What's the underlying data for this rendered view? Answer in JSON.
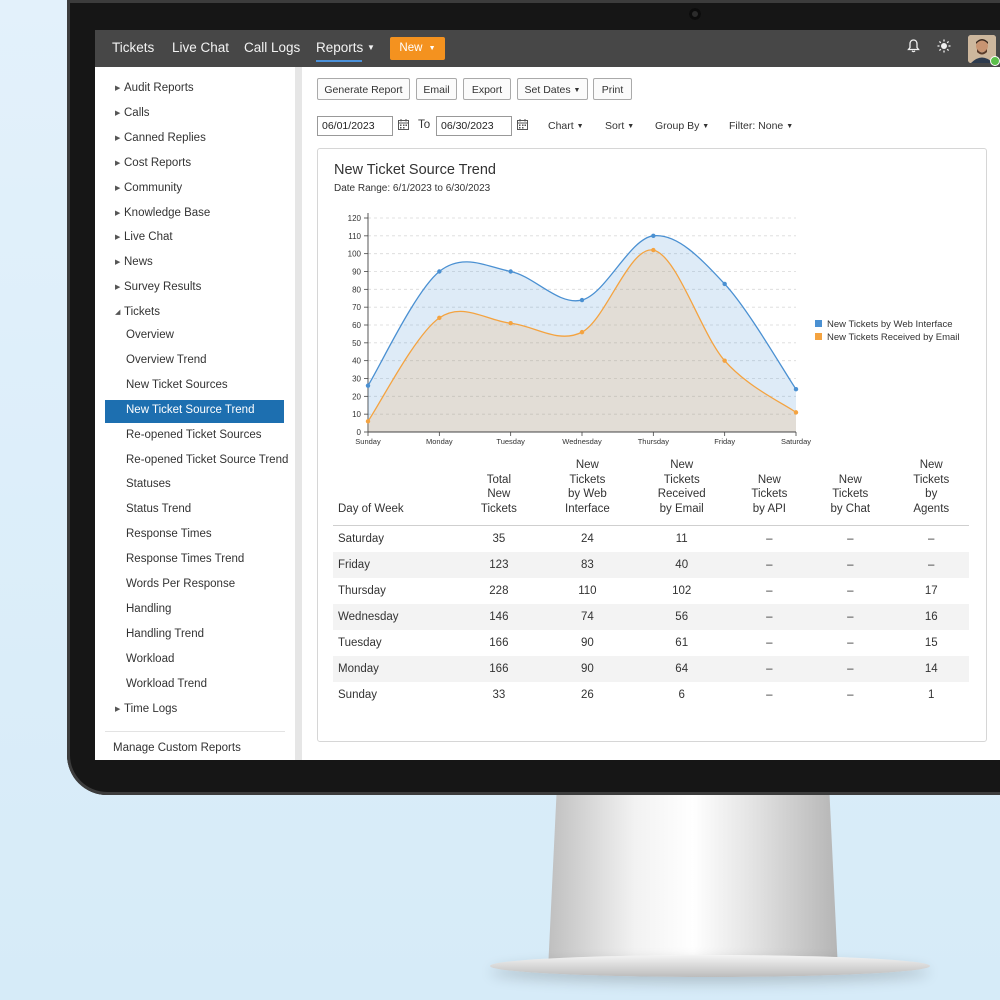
{
  "nav": {
    "tickets": "Tickets",
    "live_chat": "Live Chat",
    "call_logs": "Call Logs",
    "reports": "Reports",
    "new_button": "New",
    "bell_icon": "bell-icon",
    "theme_icon": "sun-icon"
  },
  "sidebar": {
    "groups": [
      "Audit Reports",
      "Calls",
      "Canned Replies",
      "Cost Reports",
      "Community",
      "Knowledge Base",
      "Live Chat",
      "News",
      "Survey Results",
      "Tickets"
    ],
    "tickets_items": [
      "Overview",
      "Overview Trend",
      "New Ticket Sources",
      "New Ticket Source Trend",
      "Re-opened Ticket Sources",
      "Re-opened Ticket Source Trend",
      "Statuses",
      "Status Trend",
      "Response Times",
      "Response Times Trend",
      "Words Per Response",
      "Handling",
      "Handling Trend",
      "Workload",
      "Workload Trend"
    ],
    "time_logs": "Time Logs",
    "manage": "Manage Custom Reports",
    "active": "New Ticket Source Trend"
  },
  "toolbar": {
    "generate": "Generate Report",
    "email": "Email",
    "export": "Export",
    "set_dates": "Set Dates",
    "print": "Print",
    "from_date": "06/01/2023",
    "to_label": "To",
    "to_date": "06/30/2023",
    "chart": "Chart",
    "sort": "Sort",
    "group_by": "Group By",
    "filter": "Filter: None"
  },
  "report": {
    "title": "New Ticket Source Trend",
    "date_range": "Date Range: 6/1/2023 to 6/30/2023"
  },
  "chart_data": {
    "type": "area",
    "categories": [
      "Sunday",
      "Monday",
      "Tuesday",
      "Wednesday",
      "Thursday",
      "Friday",
      "Saturday"
    ],
    "series": [
      {
        "name": "New Tickets by Web Interface",
        "values": [
          26,
          90,
          90,
          74,
          110,
          83,
          24
        ],
        "color": "#4a90d2"
      },
      {
        "name": "New Tickets Received by Email",
        "values": [
          6,
          64,
          61,
          56,
          102,
          40,
          11
        ],
        "color": "#f4a340"
      }
    ],
    "ylim": [
      0,
      120
    ],
    "yticks": [
      0,
      10,
      20,
      30,
      40,
      50,
      60,
      70,
      80,
      90,
      100,
      110,
      120
    ],
    "grid": true,
    "legend": "right"
  },
  "table": {
    "headers": [
      "Day of Week",
      "Total New Tickets",
      "New Tickets by Web Interface",
      "New Tickets Received by Email",
      "New Tickets by API",
      "New Tickets by Chat",
      "New Tickets by Agents"
    ],
    "rows": [
      [
        "Saturday",
        "35",
        "24",
        "11",
        "–",
        "–",
        "–"
      ],
      [
        "Friday",
        "123",
        "83",
        "40",
        "–",
        "–",
        "–"
      ],
      [
        "Thursday",
        "228",
        "110",
        "102",
        "–",
        "–",
        "17"
      ],
      [
        "Wednesday",
        "146",
        "74",
        "56",
        "–",
        "–",
        "16"
      ],
      [
        "Tuesday",
        "166",
        "90",
        "61",
        "–",
        "–",
        "15"
      ],
      [
        "Monday",
        "166",
        "90",
        "64",
        "–",
        "–",
        "14"
      ],
      [
        "Sunday",
        "33",
        "26",
        "6",
        "–",
        "–",
        "1"
      ]
    ]
  }
}
